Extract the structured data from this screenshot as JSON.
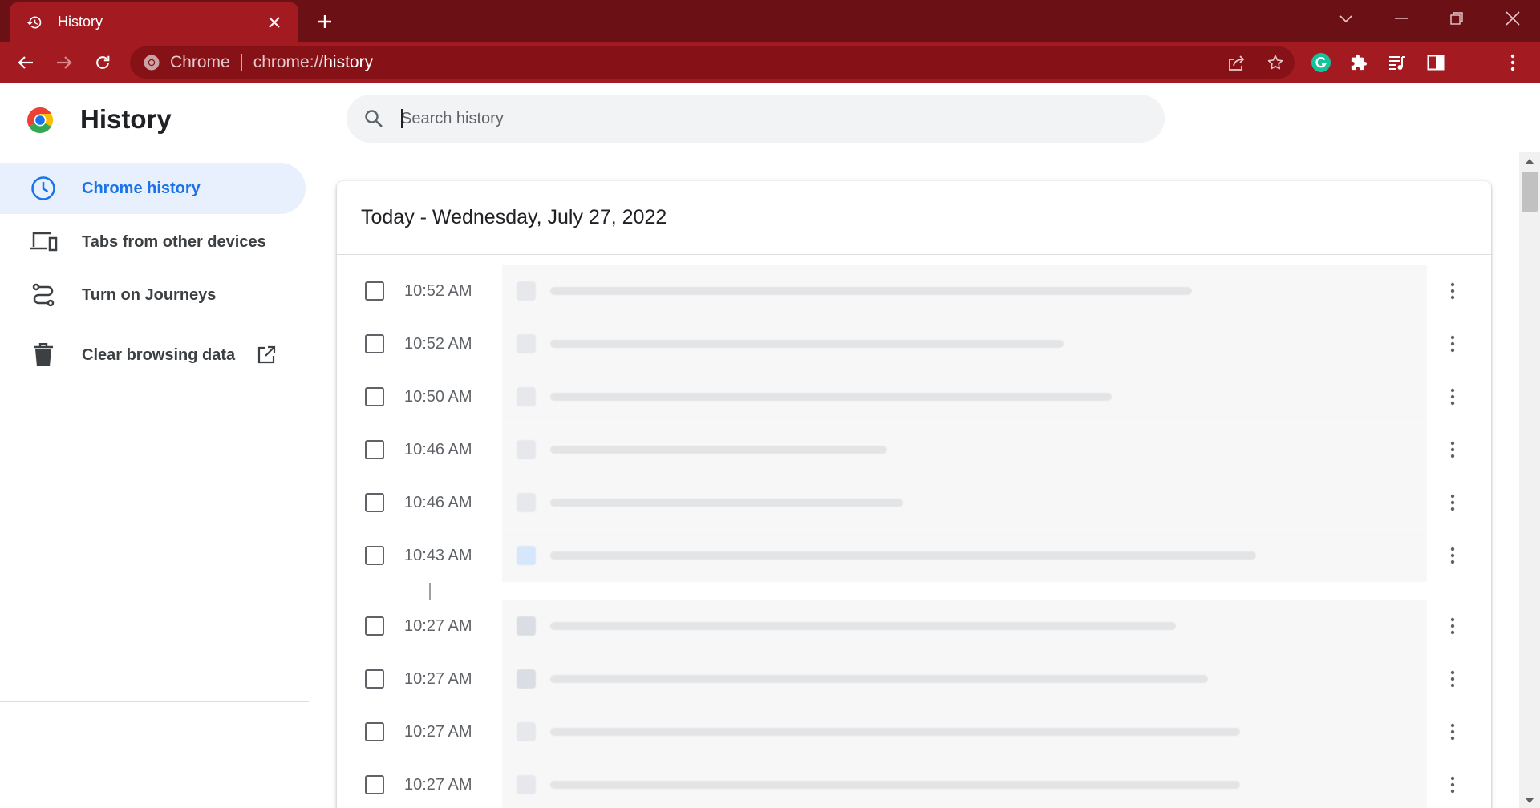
{
  "browser": {
    "tab_title": "History",
    "omnibox_chip": "Chrome",
    "url_scheme": "chrome://",
    "url_host": "history",
    "accent_color": "#a41a21",
    "frame_color": "#6b1014"
  },
  "page": {
    "title": "History"
  },
  "sidebar": {
    "items": [
      {
        "label": "Chrome history",
        "icon": "clock-icon"
      },
      {
        "label": "Tabs from other devices",
        "icon": "devices-icon"
      },
      {
        "label": "Turn on Journeys",
        "icon": "journeys-icon"
      },
      {
        "label": "Clear browsing data",
        "icon": "trash-icon"
      }
    ]
  },
  "search": {
    "placeholder": "Search history"
  },
  "history": {
    "date_header": "Today - Wednesday, July 27, 2022",
    "rows": [
      {
        "time": "10:52 AM"
      },
      {
        "time": "10:52 AM"
      },
      {
        "time": "10:50 AM"
      },
      {
        "time": "10:46 AM"
      },
      {
        "time": "10:46 AM"
      },
      {
        "time": "10:43 AM"
      },
      {
        "time": "10:27 AM"
      },
      {
        "time": "10:27 AM"
      },
      {
        "time": "10:27 AM"
      },
      {
        "time": "10:27 AM"
      }
    ]
  }
}
